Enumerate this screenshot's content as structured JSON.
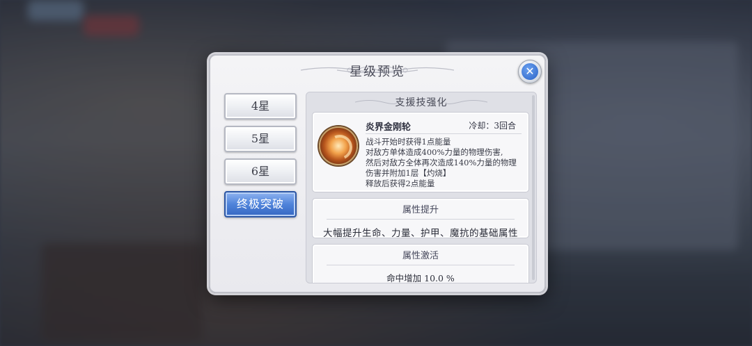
{
  "dialog": {
    "title": "星级预览",
    "close_icon": "close-x-icon"
  },
  "tabs": [
    {
      "label": "4星",
      "active": false
    },
    {
      "label": "5星",
      "active": false
    },
    {
      "label": "6星",
      "active": false
    },
    {
      "label": "终极突破",
      "active": true
    }
  ],
  "support_skill": {
    "header": "支援技强化",
    "name": "炎界金刚轮",
    "cooldown": "冷却：3回合",
    "icon": "flame-swirl-icon",
    "description_lines": [
      "战斗开始时获得1点能量",
      "对敌方单体造成400%力量的物理伤害,",
      "然后对敌方全体再次造成140%力量的物理",
      "伤害并附加1层【灼烧】",
      "释放后获得2点能量"
    ]
  },
  "attribute_boost": {
    "header": "属性提升",
    "text": "大幅提升生命、力量、护甲、魔抗的基础属性"
  },
  "attribute_activation": {
    "header": "属性激活",
    "text": "命中增加 10.0 %"
  },
  "colors": {
    "active_tab": "#4f83da",
    "dialog_bg": "#f4f4f6",
    "close_button": "#2a62c6"
  }
}
